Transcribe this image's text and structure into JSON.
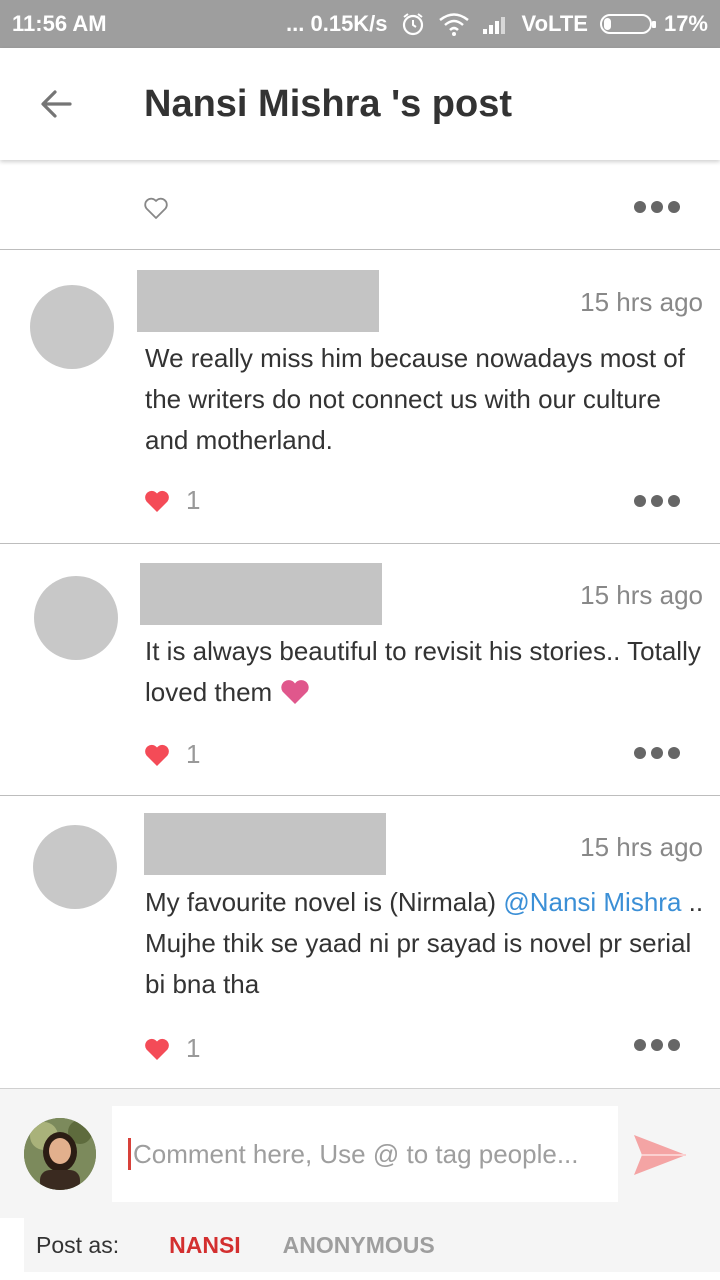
{
  "status_bar": {
    "time": "11:56 AM",
    "network_speed": "... 0.15K/s",
    "volte": "VoLTE",
    "battery_percent": "17%",
    "battery_level": 0.17,
    "icons": [
      "alarm-icon",
      "wifi-icon",
      "signal-icon",
      "battery-icon"
    ]
  },
  "app_bar": {
    "title": "Nansi Mishra 's post",
    "back_icon": "arrow-back-icon"
  },
  "post": {
    "like_icon": "heart-outline-icon",
    "more_icon": "more-dots-icon"
  },
  "comments": [
    {
      "time": "15 hrs ago",
      "text": "We really miss him because nowadays most of the writers do not connect us with our culture and motherland.",
      "likes": "1"
    },
    {
      "time": "15 hrs ago",
      "text": "It is always  beautiful to revisit his stories.. Totally loved them",
      "emoji": "heart-emoji",
      "likes": "1"
    },
    {
      "time": "15 hrs ago",
      "text_before": "My favourite novel is (Nirmala) ",
      "mention": "@Nansi Mishra",
      "text_after": " .. Mujhe thik se yaad ni pr sayad is novel pr serial bi bna tha",
      "likes": "1"
    }
  ],
  "composer": {
    "placeholder": "Comment here, Use @ to tag people...",
    "send_icon": "send-icon"
  },
  "post_as": {
    "label": "Post as:",
    "option_selected": "NANSI",
    "option_other": "ANONYMOUS"
  },
  "colors": {
    "accent_red": "#d32f2f",
    "like_red": "#f44b57",
    "mention_blue": "#3b8fd6",
    "status_bar": "#9e9e9e"
  }
}
